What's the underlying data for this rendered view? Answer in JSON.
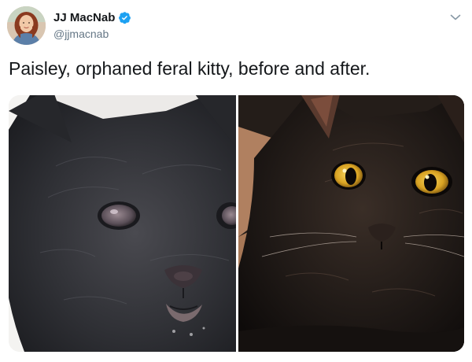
{
  "tweet": {
    "author": {
      "display_name": "JJ MacNab",
      "handle": "@jjmacnab",
      "verified": true,
      "avatar_icon": "profile-photo"
    },
    "text": "Paisley, orphaned feral kitty, before and after.",
    "media": [
      {
        "description_icon": "kitten-before-photo"
      },
      {
        "description_icon": "cat-after-photo"
      }
    ],
    "caret_icon": "chevron-down-icon"
  },
  "colors": {
    "text_primary": "#14171a",
    "text_secondary": "#657786",
    "verified_blue": "#1da1f2",
    "eye_yellow": "#e2b52a"
  }
}
